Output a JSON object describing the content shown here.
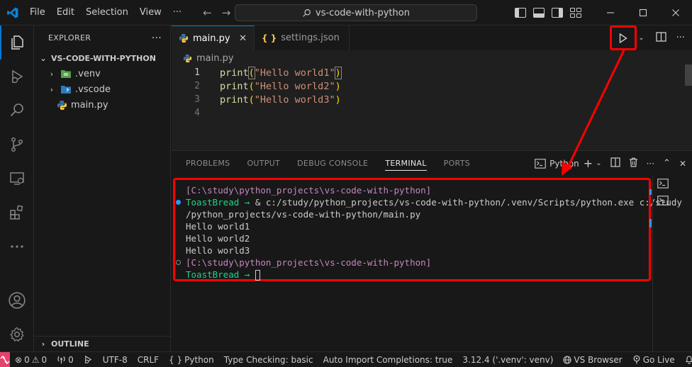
{
  "titlebar": {
    "menu": [
      "File",
      "Edit",
      "Selection",
      "View"
    ],
    "more": "···",
    "search_text": "vs-code-with-python"
  },
  "sidebar": {
    "title": "EXPLORER",
    "more": "···",
    "project": "VS-CODE-WITH-PYTHON",
    "items": [
      {
        "label": ".venv"
      },
      {
        "label": ".vscode"
      },
      {
        "label": "main.py"
      }
    ],
    "outline": "OUTLINE"
  },
  "editor": {
    "tabs": [
      {
        "label": "main.py"
      },
      {
        "label": "settings.json"
      }
    ],
    "breadcrumb": "main.py",
    "lines": [
      {
        "num": "1",
        "fn": "print",
        "open": "(",
        "str": "\"Hello world1\"",
        "close": ")"
      },
      {
        "num": "2",
        "fn": "print",
        "open": "(",
        "str": "\"Hello world2\"",
        "close": ")"
      },
      {
        "num": "3",
        "fn": "print",
        "open": "(",
        "str": "\"Hello world3\"",
        "close": ")"
      },
      {
        "num": "4",
        "fn": "",
        "open": "",
        "str": "",
        "close": ""
      }
    ]
  },
  "panel": {
    "tabs": [
      "PROBLEMS",
      "OUTPUT",
      "DEBUG CONSOLE",
      "TERMINAL",
      "PORTS"
    ],
    "terminal_name": "Python",
    "terminal": {
      "line1": "[C:\\study\\python_projects\\vs-code-with-python]",
      "prompt": "ToastBread → ",
      "command": "& c:/study/python_projects/vs-code-with-python/.venv/Scripts/python.exe c:/study",
      "command_cont": "/python_projects/vs-code-with-python/main.py",
      "out1": "Hello world1",
      "out2": "Hello world2",
      "out3": "Hello world3",
      "line2": "[C:\\study\\python_projects\\vs-code-with-python]",
      "prompt2": "ToastBread → "
    }
  },
  "statusbar": {
    "errors": "0",
    "warnings": "0",
    "ports": "0",
    "encoding": "UTF-8",
    "eol": "CRLF",
    "language": "Python",
    "type_checking": "Type Checking: basic",
    "auto_import": "Auto Import Completions: true",
    "interpreter": "3.12.4 ('.venv': venv)",
    "vs_browser": "VS Browser",
    "go_live": "Go Live"
  },
  "colors": {
    "accent": "#0078d4",
    "highlight": "#ff0000",
    "remote": "#e5426e"
  }
}
